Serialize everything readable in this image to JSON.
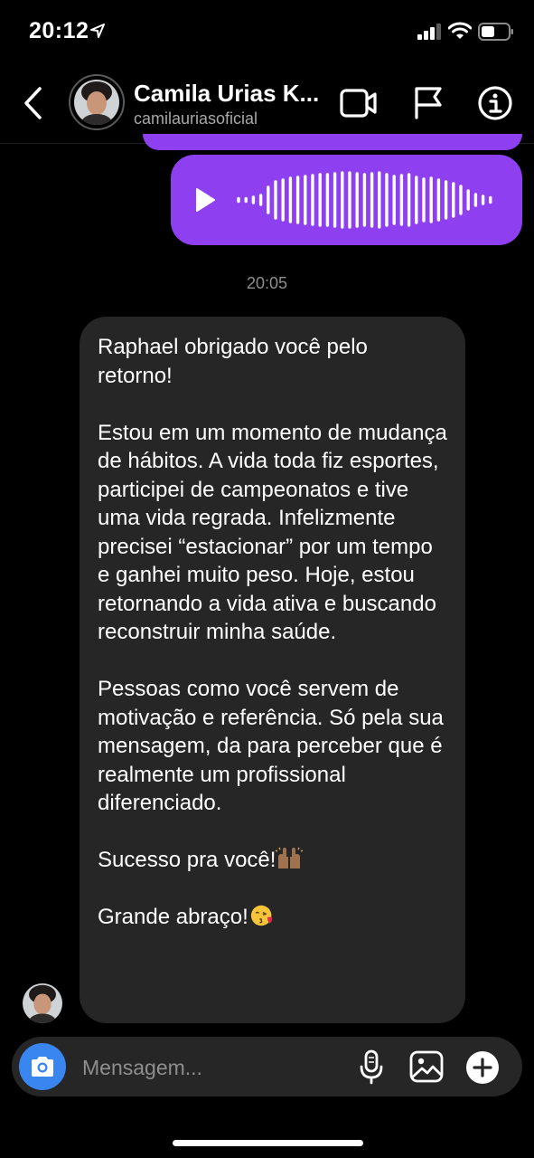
{
  "status_bar": {
    "time": "20:12",
    "icons": [
      "location-arrow-icon",
      "cellular-signal-icon",
      "wifi-icon",
      "battery-icon"
    ]
  },
  "header": {
    "contact_name": "Camila Urias K...",
    "contact_handle": "camilauriasoficial",
    "icons": [
      "back-arrow-icon",
      "video-call-icon",
      "flag-icon",
      "info-icon"
    ]
  },
  "conversation": {
    "sent_audio": {
      "type": "voice-message",
      "icon": "play-icon"
    },
    "timestamp": "20:05",
    "received_message": {
      "paragraphs": [
        "Raphael obrigado você pelo retorno!",
        "Estou em um momento de mudança de hábitos. A vida toda fiz esportes, participei de campeonatos e tive uma vida regrada. Infelizmente precisei “estacionar” por um tempo e ganhei muito peso. Hoje, estou retornando a vida ativa e buscando reconstruir minha saúde.",
        "Pessoas como você servem de motivação e referência. Só pela sua mensagem, da para perceber que é realmente um profissional diferenciado.",
        "Sucesso pra você!",
        "Grande abraço!"
      ],
      "emojis": [
        "raising-hands-emoji",
        "kissing-face-emoji"
      ]
    }
  },
  "composer": {
    "placeholder": "Mensagem...",
    "icons": [
      "camera-icon",
      "microphone-icon",
      "gallery-icon",
      "add-icon"
    ]
  },
  "colors": {
    "sent_bubble": "#8e3ff0",
    "received_bubble": "#262626",
    "camera_button": "#3a86f0",
    "background": "#000000"
  }
}
